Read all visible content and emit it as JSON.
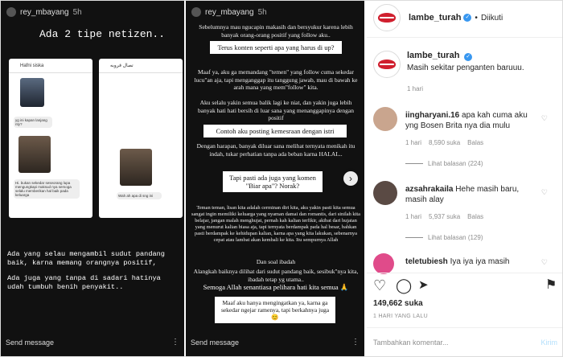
{
  "post": {
    "username": "lambe_turah",
    "follow_status": "Diikuti",
    "caption": "Masih sekitar penganten baruuu.",
    "caption_age": "1 hari",
    "likes": "149,662 suka",
    "date": "1 HARI YANG LALU",
    "comment_placeholder": "Tambahkan komentar...",
    "post_button": "Kirim"
  },
  "comments": [
    {
      "username": "iingharyani.16",
      "text": "apa kah cuma aku yng Bosen Brita nya dia mulu",
      "age": "1 hari",
      "likes": "8,590 suka",
      "reply": "Balas",
      "replies": "Lihat balasan (224)"
    },
    {
      "username": "azsahrakaila",
      "text": "Hehe masih baru, masih alay",
      "age": "1 hari",
      "likes": "5,937 suka",
      "reply": "Balas",
      "replies": "Lihat balasan (129)"
    },
    {
      "username": "teletubiesh",
      "text": "Iya iya iya masih",
      "age": "",
      "likes": "",
      "reply": "",
      "replies": ""
    }
  ],
  "story1": {
    "user": "rey_mbayang",
    "age": "5h",
    "title": "Ada 2 tipe netizen..",
    "chat_a_name": "Hafni siska",
    "chat_b_name": "تصال قروبه",
    "chat_a_msg1": "yg ini kapan lanjang nty?",
    "chat_a_msg2": "Hi. bukan sekedar seseorang lupa mengungkapi maksud nya semoga selalu memberikan hal baik pada keluarga",
    "chat_b_msg1": "Wah ah apa di sng ini",
    "text1": "Ada yang selau mengambil sudut pandang baik, karna memang orangnya positif,",
    "text2": "Ada juga yang tanpa di sadari hatinya udah tumbuh benih penyakit..",
    "send": "Send message"
  },
  "story2": {
    "user": "rey_mbayang",
    "age": "5h",
    "p1": "Sebelumnya mau ngucapin makasih dan bersyukur karena lebih banyak orang-orang positif yang follow aku..",
    "h1": "Terus konten seperti apa yang harus di up?",
    "p2": "Maaf ya, aku ga memandang \"temen\" yang follow cuma sekedar lucu\"an aja, tapi menganggap itu tanggung jawab, mau di bawah ke arah mana yang mem\"follow\" kita.",
    "p3": "Aku selalu yakin semua balik lagi ke niat, dan yakin juga lebih banyak hati hati bersih di luar sana yang menanggapinya dengan positif",
    "h2": "Contoh aku posting kemesraan dengan istri",
    "p4": "Dengan harapan, banyak diluar sana melihat ternyata menikah itu indah, tukar perhatian tanpa ada beban karna HALAL..",
    "h3": "Tapi pasti ada juga yang komen \"Biar apa\"? Norak?",
    "p5": "Teman teman, lisan kita adalah cerminan diri kita, aku yakin pasti kita semua sangat ingin memiliki keluarga yang nyaman damai dan romantis, dari sinilah kita belajar, jangan malah menghujat, pernah kah kalian terfikir, akibat dari hujatan yang menurut kalian biasa aja, tapi ternyata berdampak pada hal besar, bahkan pasti berdampak ke kehidupan kalian, karna apa yang kita lakukan, sebenarnya cepat atau lambat akan kembali ke kita. Itu sempurnya Allah",
    "p6": "Dan soal ibadah",
    "p7": "Alangkah baiknya dilihat dari sudut pandang baik, sesibuk\"nya kita, ibadah tetap yg utama..",
    "h4": "Semoga Allah senantiasa pelihara hati kita semua 🙏",
    "h5": "Maaf aku hanya mengingatkan ya, karna ga sekedar ngejar ramenya, tapi berkahnya juga 😊",
    "send": "Send message"
  },
  "icons": {
    "heart": "heart-icon",
    "comment": "comment-icon",
    "share": "share-icon",
    "save": "bookmark-icon",
    "more": "more-icon",
    "next": "chevron-right-icon"
  },
  "colors": {
    "brand_red": "#d01f2e",
    "verified_blue": "#3897f0",
    "post_disabled": "#b2dffc"
  }
}
